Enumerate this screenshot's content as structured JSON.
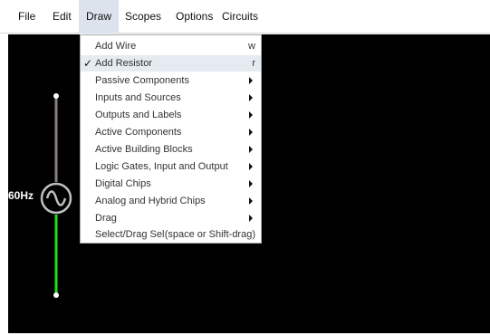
{
  "menubar": {
    "items": [
      {
        "label": "File"
      },
      {
        "label": "Edit"
      },
      {
        "label": "Draw"
      },
      {
        "label": "Scopes"
      },
      {
        "label": "Options"
      },
      {
        "label": "Circuits"
      }
    ]
  },
  "draw_menu": {
    "items": [
      {
        "label": "Add Wire",
        "shortcut": "w"
      },
      {
        "label": "Add Resistor",
        "shortcut": "r",
        "checked": true
      },
      {
        "label": "Passive Components",
        "submenu": true
      },
      {
        "label": "Inputs and Sources",
        "submenu": true
      },
      {
        "label": "Outputs and Labels",
        "submenu": true
      },
      {
        "label": "Active Components",
        "submenu": true
      },
      {
        "label": "Active Building Blocks",
        "submenu": true
      },
      {
        "label": "Logic Gates, Input and Output",
        "submenu": true
      },
      {
        "label": "Digital Chips",
        "submenu": true
      },
      {
        "label": "Analog and Hybrid Chips",
        "submenu": true
      },
      {
        "label": "Drag",
        "submenu": true
      },
      {
        "label": "Select/Drag Sel",
        "shortcut": "(space or Shift-drag)"
      }
    ],
    "check_mark": "✓"
  },
  "canvas": {
    "source_label": "60Hz",
    "colors": {
      "background": "#000000",
      "wire_top": "#8a7f7f",
      "wire_bottom": "#22dd22",
      "node": "#ffffff",
      "source": "#bfbfbf"
    }
  }
}
